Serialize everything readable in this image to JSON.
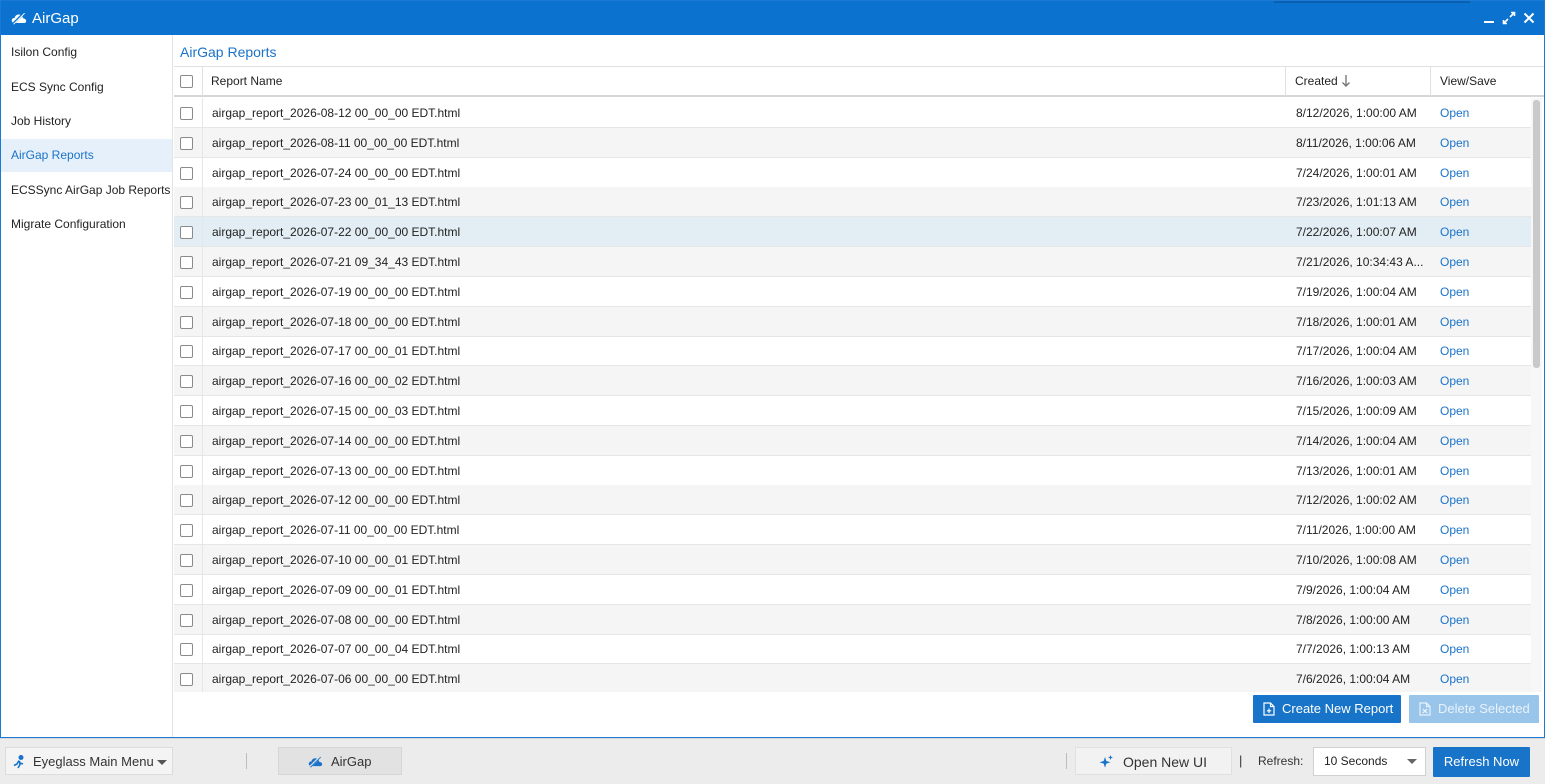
{
  "window": {
    "title": "AirGap"
  },
  "sidebar": {
    "items": [
      {
        "label": "Isilon Config"
      },
      {
        "label": "ECS Sync Config"
      },
      {
        "label": "Job History"
      },
      {
        "label": "AirGap Reports",
        "active": true
      },
      {
        "label": "ECSSync AirGap Job Reports"
      },
      {
        "label": "Migrate Configuration"
      }
    ]
  },
  "main": {
    "title": "AirGap Reports",
    "columns": {
      "name": "Report Name",
      "created": "Created",
      "view": "View/Save"
    },
    "sort": {
      "column": "created",
      "direction": "descending"
    },
    "rows": [
      {
        "name": "airgap_report_2026-08-12 00_00_00 EDT.html",
        "created": "8/12/2026, 1:00:00 AM",
        "action": "Open"
      },
      {
        "name": "airgap_report_2026-08-11 00_00_00 EDT.html",
        "created": "8/11/2026, 1:00:06 AM",
        "action": "Open"
      },
      {
        "name": "airgap_report_2026-07-24 00_00_00 EDT.html",
        "created": "7/24/2026, 1:00:01 AM",
        "action": "Open"
      },
      {
        "name": "airgap_report_2026-07-23 00_01_13 EDT.html",
        "created": "7/23/2026, 1:01:13 AM",
        "action": "Open"
      },
      {
        "name": "airgap_report_2026-07-22 00_00_00 EDT.html",
        "created": "7/22/2026, 1:00:07 AM",
        "action": "Open",
        "highlighted": true
      },
      {
        "name": "airgap_report_2026-07-21 09_34_43 EDT.html",
        "created": "7/21/2026, 10:34:43 A...",
        "action": "Open"
      },
      {
        "name": "airgap_report_2026-07-19 00_00_00 EDT.html",
        "created": "7/19/2026, 1:00:04 AM",
        "action": "Open"
      },
      {
        "name": "airgap_report_2026-07-18 00_00_00 EDT.html",
        "created": "7/18/2026, 1:00:01 AM",
        "action": "Open"
      },
      {
        "name": "airgap_report_2026-07-17 00_00_01 EDT.html",
        "created": "7/17/2026, 1:00:04 AM",
        "action": "Open"
      },
      {
        "name": "airgap_report_2026-07-16 00_00_02 EDT.html",
        "created": "7/16/2026, 1:00:03 AM",
        "action": "Open"
      },
      {
        "name": "airgap_report_2026-07-15 00_00_03 EDT.html",
        "created": "7/15/2026, 1:00:09 AM",
        "action": "Open"
      },
      {
        "name": "airgap_report_2026-07-14 00_00_00 EDT.html",
        "created": "7/14/2026, 1:00:04 AM",
        "action": "Open"
      },
      {
        "name": "airgap_report_2026-07-13 00_00_00 EDT.html",
        "created": "7/13/2026, 1:00:01 AM",
        "action": "Open"
      },
      {
        "name": "airgap_report_2026-07-12 00_00_00 EDT.html",
        "created": "7/12/2026, 1:00:02 AM",
        "action": "Open"
      },
      {
        "name": "airgap_report_2026-07-11 00_00_00 EDT.html",
        "created": "7/11/2026, 1:00:00 AM",
        "action": "Open"
      },
      {
        "name": "airgap_report_2026-07-10 00_00_01 EDT.html",
        "created": "7/10/2026, 1:00:08 AM",
        "action": "Open"
      },
      {
        "name": "airgap_report_2026-07-09 00_00_01 EDT.html",
        "created": "7/9/2026, 1:00:04 AM",
        "action": "Open"
      },
      {
        "name": "airgap_report_2026-07-08 00_00_00 EDT.html",
        "created": "7/8/2026, 1:00:00 AM",
        "action": "Open"
      },
      {
        "name": "airgap_report_2026-07-07 00_00_04 EDT.html",
        "created": "7/7/2026, 1:00:13 AM",
        "action": "Open"
      },
      {
        "name": "airgap_report_2026-07-06 00_00_00 EDT.html",
        "created": "7/6/2026, 1:00:04 AM",
        "action": "Open"
      }
    ],
    "buttons": {
      "create": "Create New Report",
      "delete": "Delete Selected"
    }
  },
  "taskbar": {
    "main_menu": "Eyeglass Main Menu",
    "app_tab": "AirGap",
    "open_new_ui": "Open New UI",
    "divider": "|",
    "refresh_label": "Refresh:",
    "refresh_value": "10 Seconds",
    "refresh_now": "Refresh Now"
  },
  "colors": {
    "title_bar": "#0b73cf",
    "accent": "#1a73c9",
    "active_nav_bg": "#e6f0fa",
    "highlighted_row": "#e3edf4",
    "disabled_button": "#9ac5ea"
  },
  "icons": {
    "app": "airgap-cloud-icon",
    "minimize": "minimize-icon",
    "restore": "restore-icon",
    "close": "close-icon",
    "sort": "sort-down-arrow-icon",
    "create": "new-document-icon",
    "delete": "delete-document-icon",
    "main_menu": "eyeglass-astronaut-icon",
    "open_new_ui": "sparkle-icon"
  }
}
